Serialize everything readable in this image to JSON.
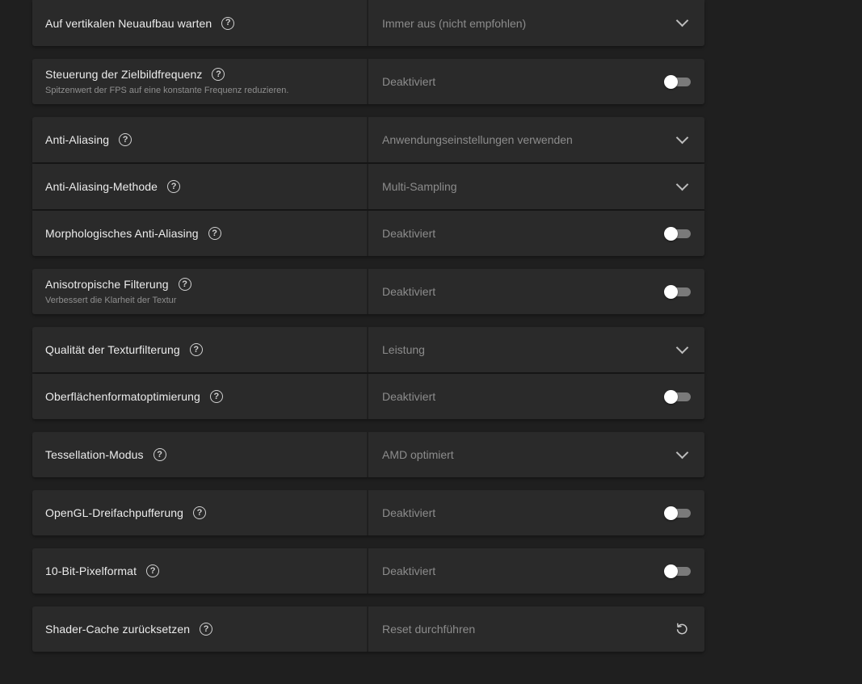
{
  "settings": [
    {
      "label": "Auf vertikalen Neuaufbau warten",
      "value": "Immer aus (nicht empfohlen)",
      "control": "dropdown"
    },
    {
      "label": "Steuerung der Zielbildfrequenz",
      "description": "Spitzenwert der FPS auf eine konstante Frequenz reduzieren.",
      "value": "Deaktiviert",
      "control": "toggle",
      "enabled": false
    },
    {
      "label": "Anti-Aliasing",
      "value": "Anwendungseinstellungen verwenden",
      "control": "dropdown"
    },
    {
      "label": "Anti-Aliasing-Methode",
      "value": "Multi-Sampling",
      "control": "dropdown"
    },
    {
      "label": "Morphologisches Anti-Aliasing",
      "value": "Deaktiviert",
      "control": "toggle",
      "enabled": false
    },
    {
      "label": "Anisotropische Filterung",
      "description": "Verbessert die Klarheit der Textur",
      "value": "Deaktiviert",
      "control": "toggle",
      "enabled": false
    },
    {
      "label": "Qualität der Texturfilterung",
      "value": "Leistung",
      "control": "dropdown"
    },
    {
      "label": "Oberflächenformatoptimierung",
      "value": "Deaktiviert",
      "control": "toggle",
      "enabled": false
    },
    {
      "label": "Tessellation-Modus",
      "value": "AMD optimiert",
      "control": "dropdown"
    },
    {
      "label": "OpenGL-Dreifachpufferung",
      "value": "Deaktiviert",
      "control": "toggle",
      "enabled": false
    },
    {
      "label": "10-Bit-Pixelformat",
      "value": "Deaktiviert",
      "control": "toggle",
      "enabled": false
    },
    {
      "label": "Shader-Cache zurücksetzen",
      "value": "Reset durchführen",
      "control": "reset"
    }
  ],
  "help_glyph": "?",
  "icons": {
    "help": "question-circle-icon",
    "dropdown": "chevron-down-icon",
    "reset": "reset-arrow-icon"
  },
  "colors": {
    "background": "#1f1f1f",
    "panel": "#2a2a2a",
    "label": "#ececec",
    "value": "#8c8c8c",
    "toggle_track_off": "#7a7a7a",
    "toggle_knob": "#ffffff"
  }
}
